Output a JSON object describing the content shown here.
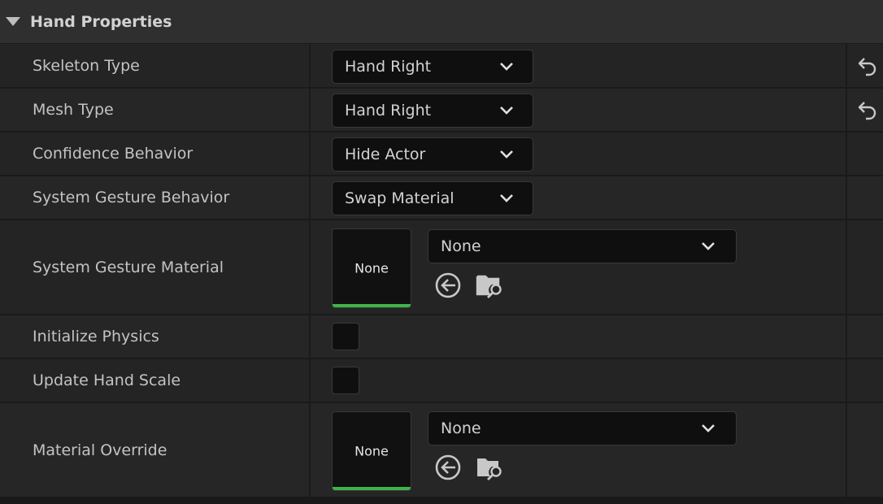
{
  "section": {
    "title": "Hand Properties"
  },
  "rows": {
    "skeleton_type": {
      "label": "Skeleton Type",
      "value": "Hand Right"
    },
    "mesh_type": {
      "label": "Mesh Type",
      "value": "Hand Right"
    },
    "confidence_behavior": {
      "label": "Confidence Behavior",
      "value": "Hide Actor"
    },
    "system_gesture_behavior": {
      "label": "System Gesture Behavior",
      "value": "Swap Material"
    },
    "system_gesture_material": {
      "label": "System Gesture Material",
      "thumbnail": "None",
      "value": "None"
    },
    "initialize_physics": {
      "label": "Initialize Physics",
      "checked": false
    },
    "update_hand_scale": {
      "label": "Update Hand Scale",
      "checked": false
    },
    "material_override": {
      "label": "Material Override",
      "thumbnail": "None",
      "value": "None"
    }
  },
  "icons": {
    "section_toggle": "collapse-triangle-icon",
    "reset": "reset-to-default-icon",
    "use_selected": "use-selected-asset-icon",
    "browse": "browse-folder-icon",
    "dropdown": "chevron-down-icon"
  },
  "colors": {
    "background": "#1a1a1a",
    "row": "#242424",
    "header": "#2f2f2f",
    "field": "#0f0f0f",
    "asset_bar": "#3eb34a",
    "text": "#c3c3c3"
  }
}
